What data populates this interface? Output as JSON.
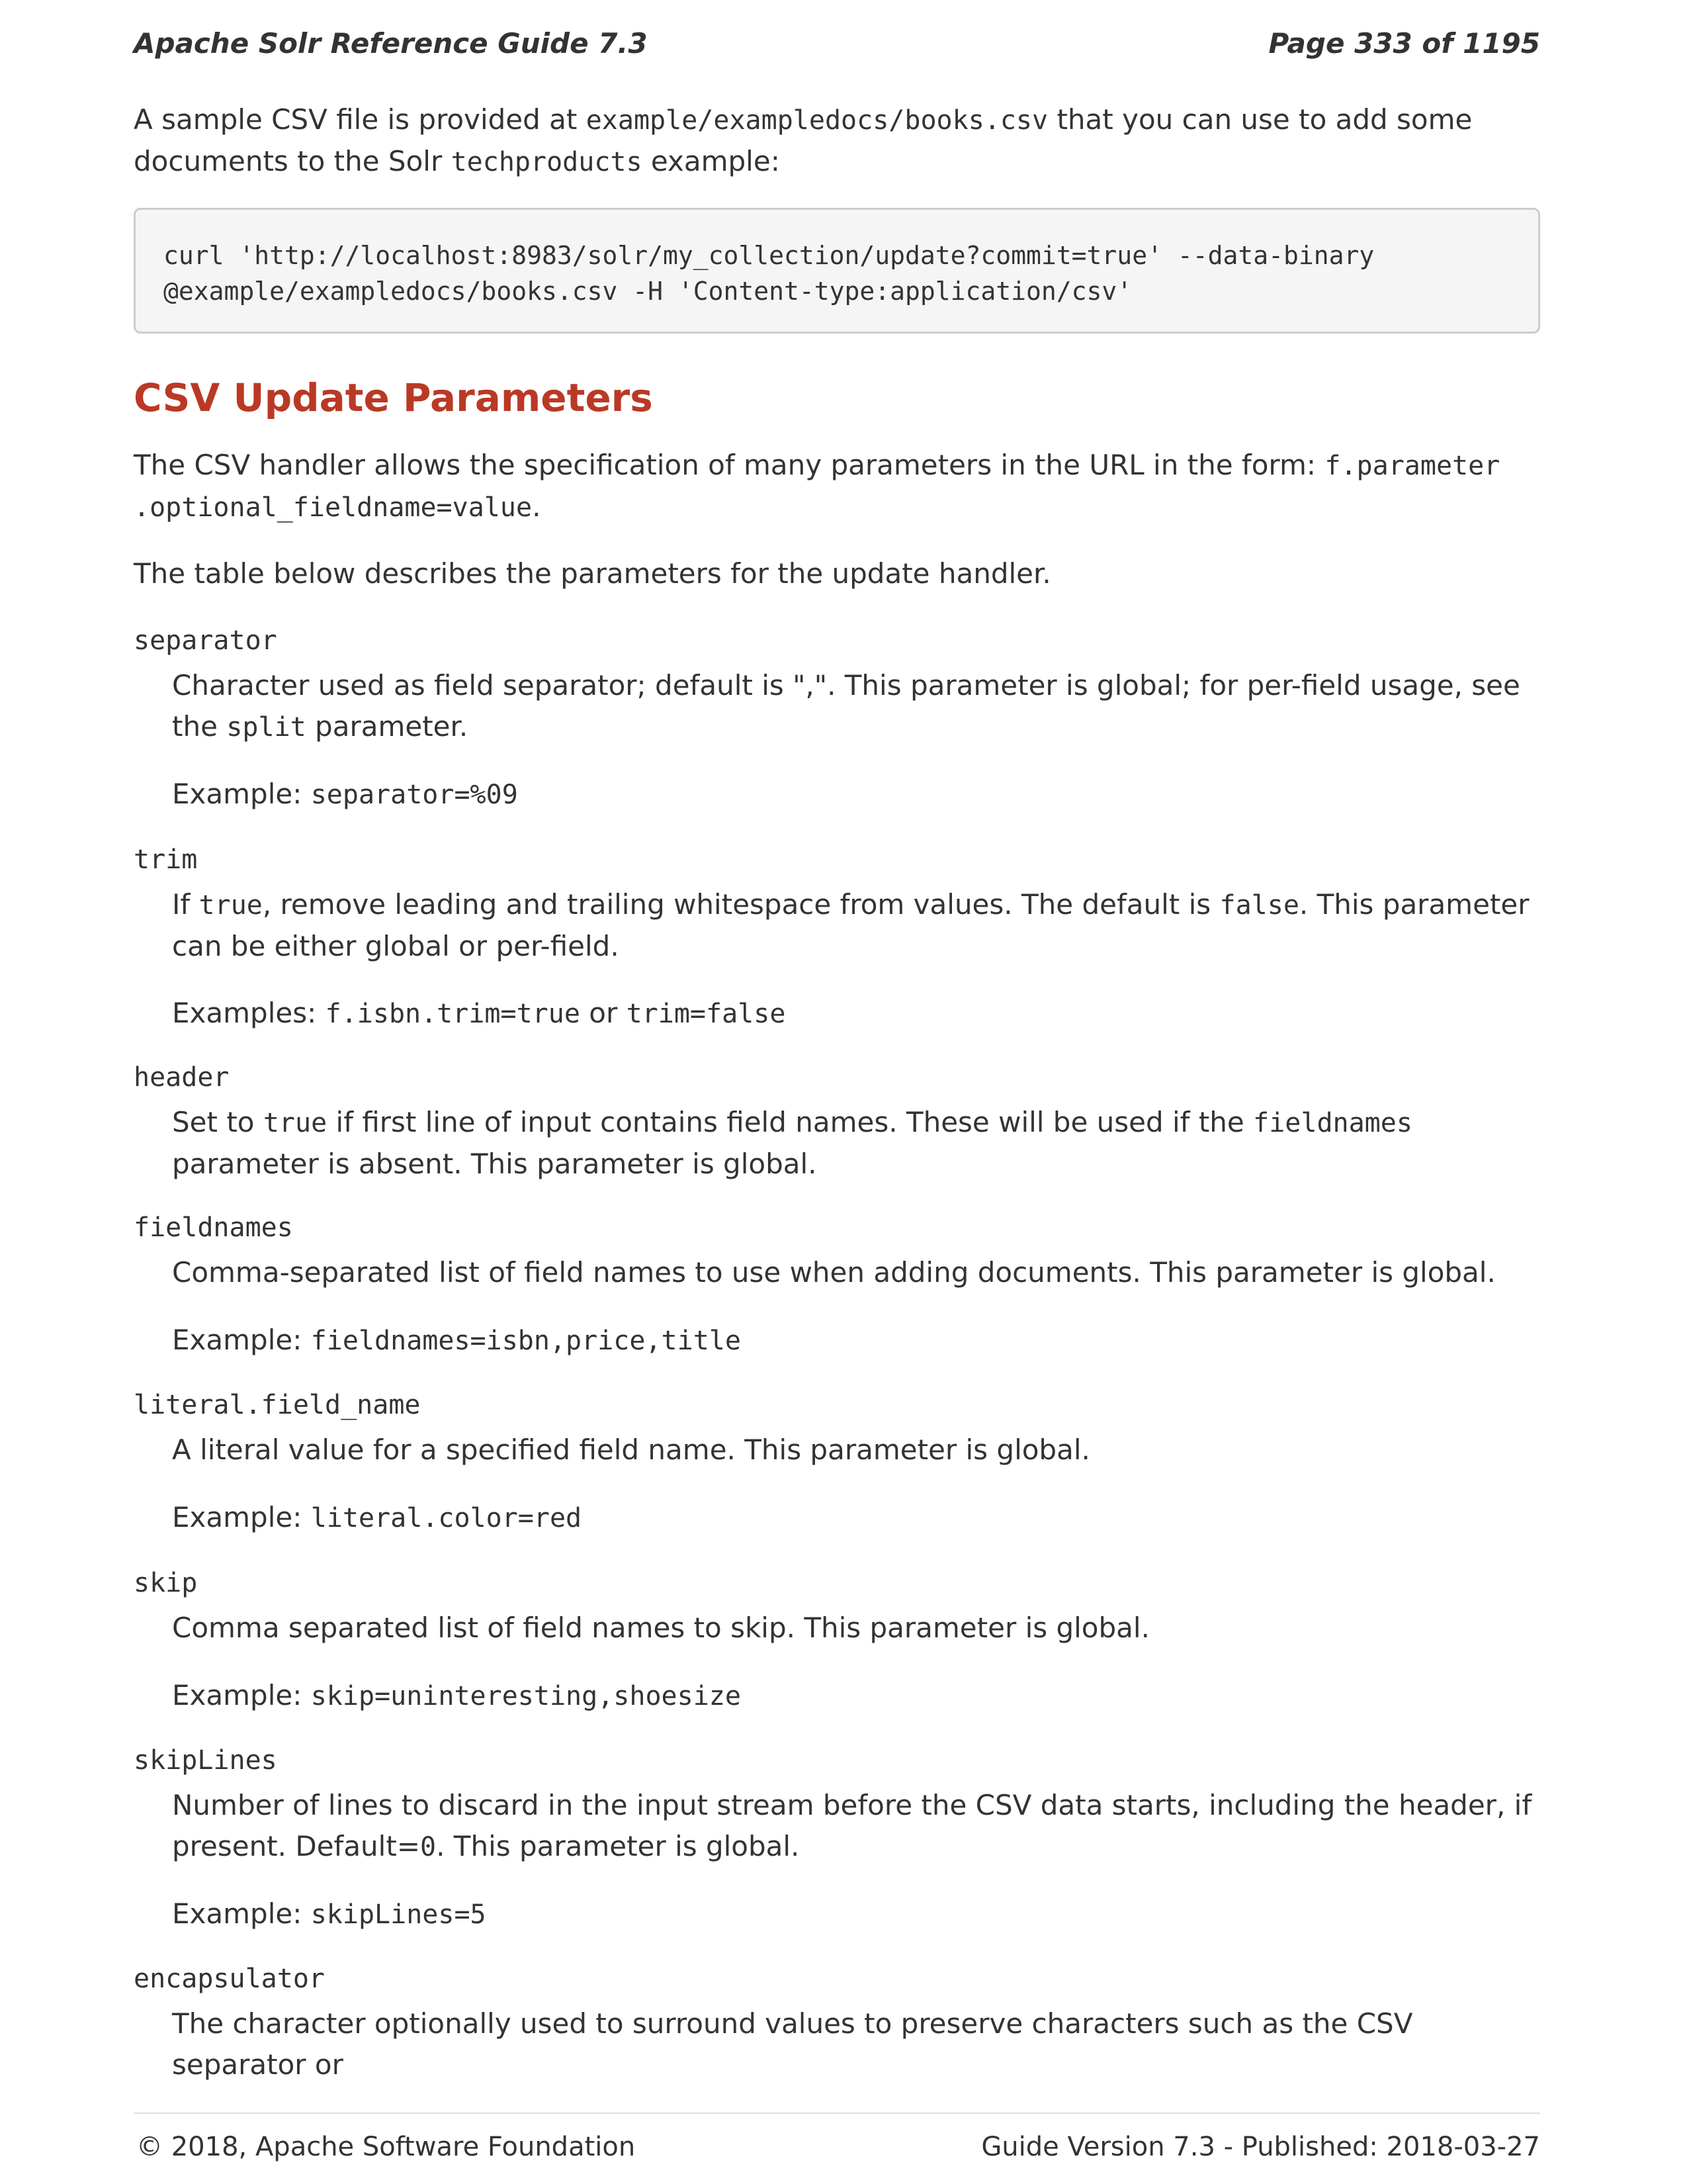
{
  "header": {
    "title": "Apache Solr Reference Guide 7.3",
    "page": "Page 333 of 1195"
  },
  "intro": {
    "t1": "A sample CSV file is provided at ",
    "c1": "example/exampledocs/books.csv",
    "t2": " that you can use to add some documents to the Solr ",
    "c2": "techproducts",
    "t3": " example:"
  },
  "code": {
    "line1": "curl 'http://localhost:8983/solr/my_collection/update?commit=true' --data-binary",
    "line2": "@example/exampledocs/books.csv -H 'Content-type:application/csv'"
  },
  "section": {
    "title": "CSV Update Parameters",
    "p1_text": "The CSV handler allows the specification of many parameters in the URL in the form: ",
    "p1_code": "f.parameter .optional_fieldname=value",
    "p1_end": ".",
    "p2": "The table below describes the parameters for the update handler."
  },
  "params": {
    "separator": {
      "term": "separator",
      "d1": "Character used as field separator; default is \",\". This parameter is global; for per-field usage, see the ",
      "d1c": "split",
      "d1e": " parameter.",
      "ex_label": "Example: ",
      "ex_code": "separator=%09"
    },
    "trim": {
      "term": "trim",
      "d1a": "If ",
      "d1b": "true",
      "d1c": ", remove leading and trailing whitespace from values. The default is ",
      "d1d": "false",
      "d1e": ". This parameter can be either global or per-field.",
      "ex_label": "Examples: ",
      "ex_code1": "f.isbn.trim=true",
      "ex_or": " or ",
      "ex_code2": "trim=false"
    },
    "header": {
      "term": "header",
      "d1a": "Set to ",
      "d1b": "true",
      "d1c": " if first line of input contains field names. These will be used if the ",
      "d1d": "fieldnames",
      "d1e": " parameter is absent. This parameter is global."
    },
    "fieldnames": {
      "term": "fieldnames",
      "d1": "Comma-separated list of field names to use when adding documents. This parameter is global.",
      "ex_label": "Example: ",
      "ex_code": "fieldnames=isbn,price,title"
    },
    "literal": {
      "term": "literal.field_name",
      "d1": "A literal value for a specified field name. This parameter is global.",
      "ex_label": "Example: ",
      "ex_code": "literal.color=red"
    },
    "skip": {
      "term": "skip",
      "d1": "Comma separated list of field names to skip. This parameter is global.",
      "ex_label": "Example: ",
      "ex_code": "skip=uninteresting,shoesize"
    },
    "skipLines": {
      "term": "skipLines",
      "d1a": "Number of lines to discard in the input stream before the CSV data starts, including the header, if present. Default=",
      "d1b": "0",
      "d1c": ". This parameter is global.",
      "ex_label": "Example: ",
      "ex_code": "skipLines=5"
    },
    "encapsulator": {
      "term": "encapsulator",
      "d1": "The character optionally used to surround values to preserve characters such as the CSV separator or"
    }
  },
  "footer": {
    "copyright": "© 2018, Apache Software Foundation",
    "version": "Guide Version 7.3 - Published: 2018-03-27"
  }
}
